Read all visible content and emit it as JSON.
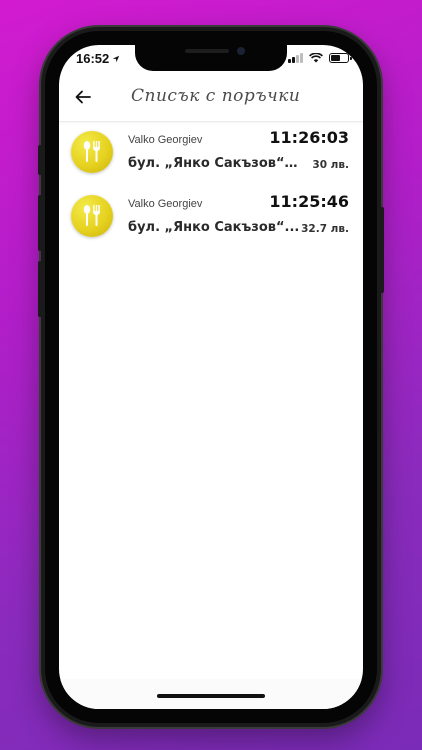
{
  "status_bar": {
    "time": "16:52",
    "location_icon": "location-arrow-icon",
    "signal_icon": "cellular-signal-icon",
    "wifi_icon": "wifi-icon",
    "battery_icon": "battery-icon",
    "battery_level": 0.6
  },
  "header": {
    "back_icon": "arrow-left-icon",
    "title": "Списък с поръчки"
  },
  "orders": [
    {
      "icon": "fork-spoon-icon",
      "customer": "Valko Georgiev",
      "time": "11:26:03",
      "address": "бул. „Янко Сакъзов“ 1...",
      "price": "30 лв."
    },
    {
      "icon": "fork-spoon-icon",
      "customer": "Valko Georgiev",
      "time": "11:25:46",
      "address": "бул. „Янко Сакъзов“...",
      "price": "32.7 лв."
    }
  ],
  "colors": {
    "background_top": "#d21bd0",
    "background_bottom": "#7a2bb7",
    "avatar_yellow": "#e6d21f"
  }
}
